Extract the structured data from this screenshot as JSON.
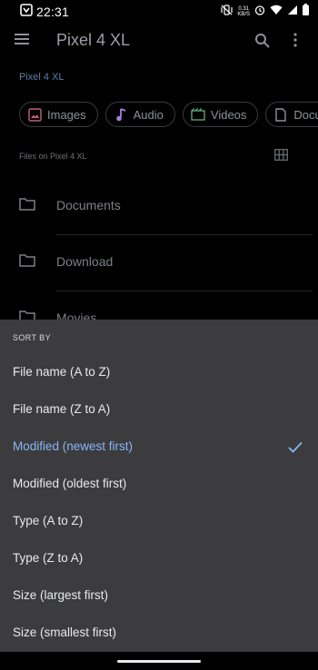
{
  "status_bar": {
    "time": "22:31",
    "net_speed_top": "0.31",
    "net_speed_bottom": "KB/S",
    "icons": [
      "notification-badge-icon",
      "vibrate-icon",
      "alarm-icon",
      "wifi-icon",
      "signal-icon",
      "battery-icon"
    ]
  },
  "app_bar": {
    "title": "Pixel 4 XL"
  },
  "breadcrumb": "Pixel 4 XL",
  "chips": [
    {
      "label": "Images",
      "icon": "image-icon",
      "color": "#c2607a"
    },
    {
      "label": "Audio",
      "icon": "music-note-icon",
      "color": "#a47fe0"
    },
    {
      "label": "Videos",
      "icon": "movie-icon",
      "color": "#5aa27a"
    },
    {
      "label": "Documents",
      "icon": "document-icon",
      "color": "#8e9297"
    }
  ],
  "section_label": "Files on Pixel 4 XL",
  "folders": [
    {
      "name": "Documents"
    },
    {
      "name": "Download"
    },
    {
      "name": "Movies"
    }
  ],
  "sort_sheet": {
    "heading": "SORT BY",
    "options": [
      {
        "label": "File name (A to Z)",
        "selected": false
      },
      {
        "label": "File name (Z to A)",
        "selected": false
      },
      {
        "label": "Modified (newest first)",
        "selected": true
      },
      {
        "label": "Modified (oldest first)",
        "selected": false
      },
      {
        "label": "Type (A to Z)",
        "selected": false
      },
      {
        "label": "Type (Z to A)",
        "selected": false
      },
      {
        "label": "Size (largest first)",
        "selected": false
      },
      {
        "label": "Size (smallest first)",
        "selected": false
      }
    ]
  },
  "colors": {
    "accent": "#8ab4f8",
    "sheet_bg": "#3c3c3e",
    "background": "#000000"
  }
}
